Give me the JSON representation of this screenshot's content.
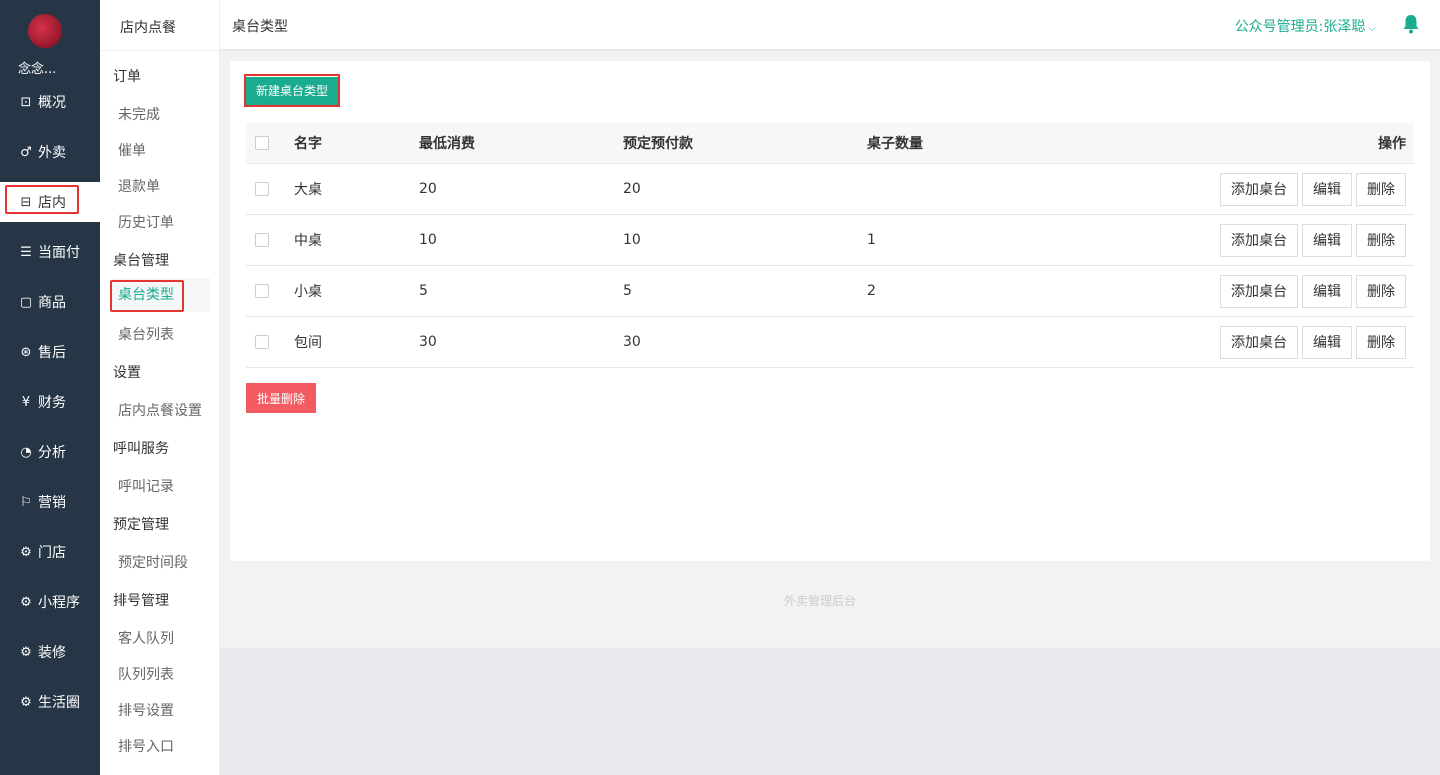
{
  "nav": {
    "shop_name": "念念...",
    "items": [
      {
        "label": "概况",
        "icon": "overview-icon",
        "glyph": "⊡"
      },
      {
        "label": "外卖",
        "icon": "delivery-icon",
        "glyph": "♂"
      },
      {
        "label": "店内",
        "icon": "store-icon",
        "glyph": "⊟"
      },
      {
        "label": "当面付",
        "icon": "receipt-icon",
        "glyph": "☰"
      },
      {
        "label": "商品",
        "icon": "bag-icon",
        "glyph": "▢"
      },
      {
        "label": "售后",
        "icon": "aftersale-icon",
        "glyph": "⊛"
      },
      {
        "label": "财务",
        "icon": "yen-icon",
        "glyph": "¥"
      },
      {
        "label": "分析",
        "icon": "chart-icon",
        "glyph": "◔"
      },
      {
        "label": "营销",
        "icon": "flag-icon",
        "glyph": "⚐"
      },
      {
        "label": "门店",
        "icon": "gear-icon",
        "glyph": "⚙"
      },
      {
        "label": "小程序",
        "icon": "gear-icon",
        "glyph": "⚙"
      },
      {
        "label": "装修",
        "icon": "gear-icon",
        "glyph": "⚙"
      },
      {
        "label": "生活圈",
        "icon": "gear-icon",
        "glyph": "⚙"
      }
    ]
  },
  "subnav": {
    "title": "店内点餐",
    "groups": [
      {
        "label": "订单",
        "links": [
          "未完成",
          "催单",
          "退款单",
          "历史订单"
        ]
      },
      {
        "label": "桌台管理",
        "links": [
          "桌台类型",
          "桌台列表"
        ]
      },
      {
        "label": "设置",
        "links": [
          "店内点餐设置"
        ]
      },
      {
        "label": "呼叫服务",
        "links": [
          "呼叫记录"
        ]
      },
      {
        "label": "预定管理",
        "links": [
          "预定时间段"
        ]
      },
      {
        "label": "排号管理",
        "links": [
          "客人队列",
          "队列列表",
          "排号设置",
          "排号入口"
        ]
      }
    ]
  },
  "header": {
    "page_title": "桌台类型",
    "admin_label": "公众号管理员:张泽聪"
  },
  "toolbar": {
    "new_label": "新建桌台类型",
    "batch_delete_label": "批量删除"
  },
  "table": {
    "headers": {
      "name": "名字",
      "min": "最低消费",
      "prepay": "预定预付款",
      "count": "桌子数量",
      "ops": "操作"
    },
    "rows": [
      {
        "name": "大桌",
        "min": "20",
        "prepay": "20",
        "count": ""
      },
      {
        "name": "中桌",
        "min": "10",
        "prepay": "10",
        "count": "1"
      },
      {
        "name": "小桌",
        "min": "5",
        "prepay": "5",
        "count": "2"
      },
      {
        "name": "包间",
        "min": "30",
        "prepay": "30",
        "count": ""
      }
    ],
    "actions": {
      "add": "添加桌台",
      "edit": "编辑",
      "delete": "删除"
    }
  },
  "footer": {
    "text": "外卖管理后台"
  },
  "colors": {
    "accent": "#1aac8f",
    "danger": "#f35b63",
    "sidebar": "#263646",
    "highlight": "#e3342f"
  }
}
